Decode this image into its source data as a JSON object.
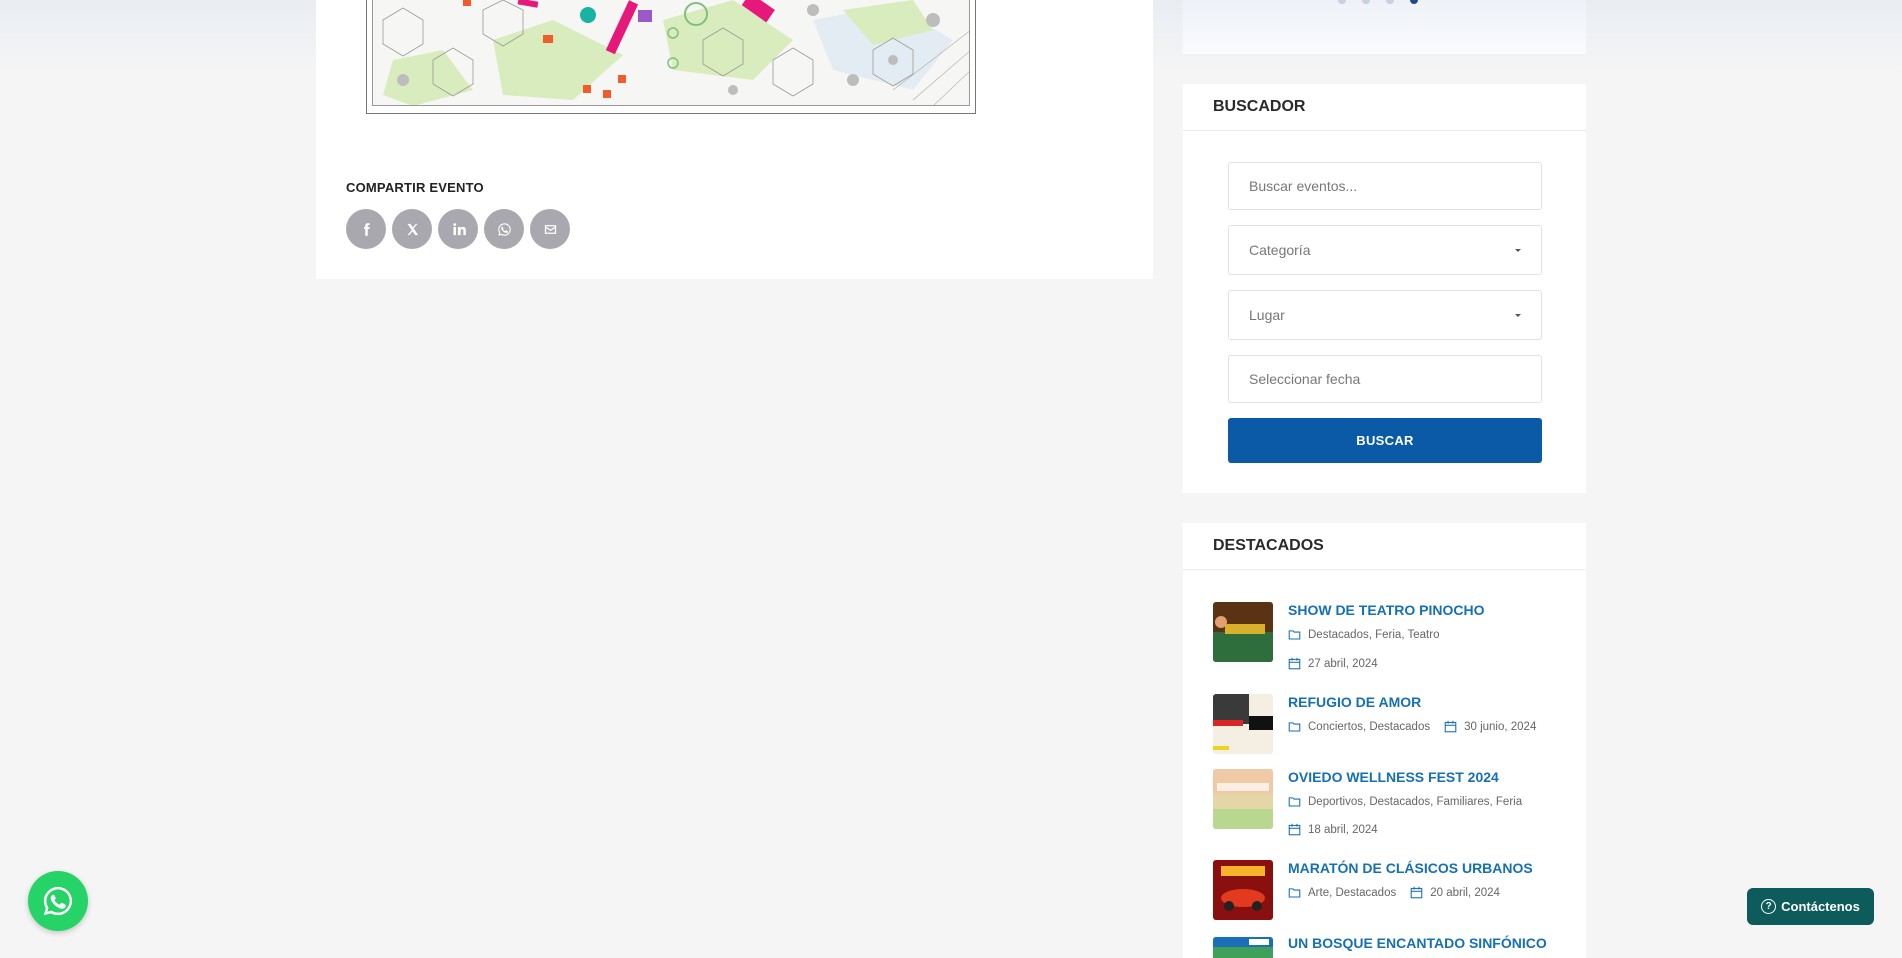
{
  "share": {
    "title": "COMPARTIR EVENTO",
    "buttons": [
      {
        "icon": "facebook-icon"
      },
      {
        "icon": "x-twitter-icon"
      },
      {
        "icon": "linkedin-icon"
      },
      {
        "icon": "whatsapp-icon"
      },
      {
        "icon": "email-icon"
      }
    ]
  },
  "search": {
    "header": "BUSCADOR",
    "keyword_placeholder": "Buscar eventos...",
    "category_placeholder": "Categoría",
    "place_placeholder": "Lugar",
    "date_placeholder": "Seleccionar fecha",
    "button_label": "BUSCAR"
  },
  "featured": {
    "header": "DESTACADOS",
    "events": [
      {
        "title": "SHOW DE TEATRO PINOCHO",
        "categories": "Destacados,  Feria,  Teatro",
        "date": "27 abril, 2024"
      },
      {
        "title": "REFUGIO DE AMOR",
        "categories": "Conciertos,  Destacados",
        "date": "30 junio, 2024"
      },
      {
        "title": "OVIEDO WELLNESS FEST 2024",
        "categories": "Deportivos,  Destacados,  Familiares,  Feria",
        "date": "18 abril, 2024"
      },
      {
        "title": "MARATÓN DE CLÁSICOS URBANOS",
        "categories": "Arte,  Destacados",
        "date": "20 abril, 2024"
      },
      {
        "title": "UN BOSQUE ENCANTADO SINFÓNICO",
        "categories": "",
        "date": ""
      }
    ]
  },
  "contact": {
    "label": "Contáctenos"
  },
  "colors": {
    "primary": "#0b5aa8",
    "link": "#1670b4",
    "whatsapp": "#25d366",
    "contact_bg": "#0e5b5b"
  }
}
